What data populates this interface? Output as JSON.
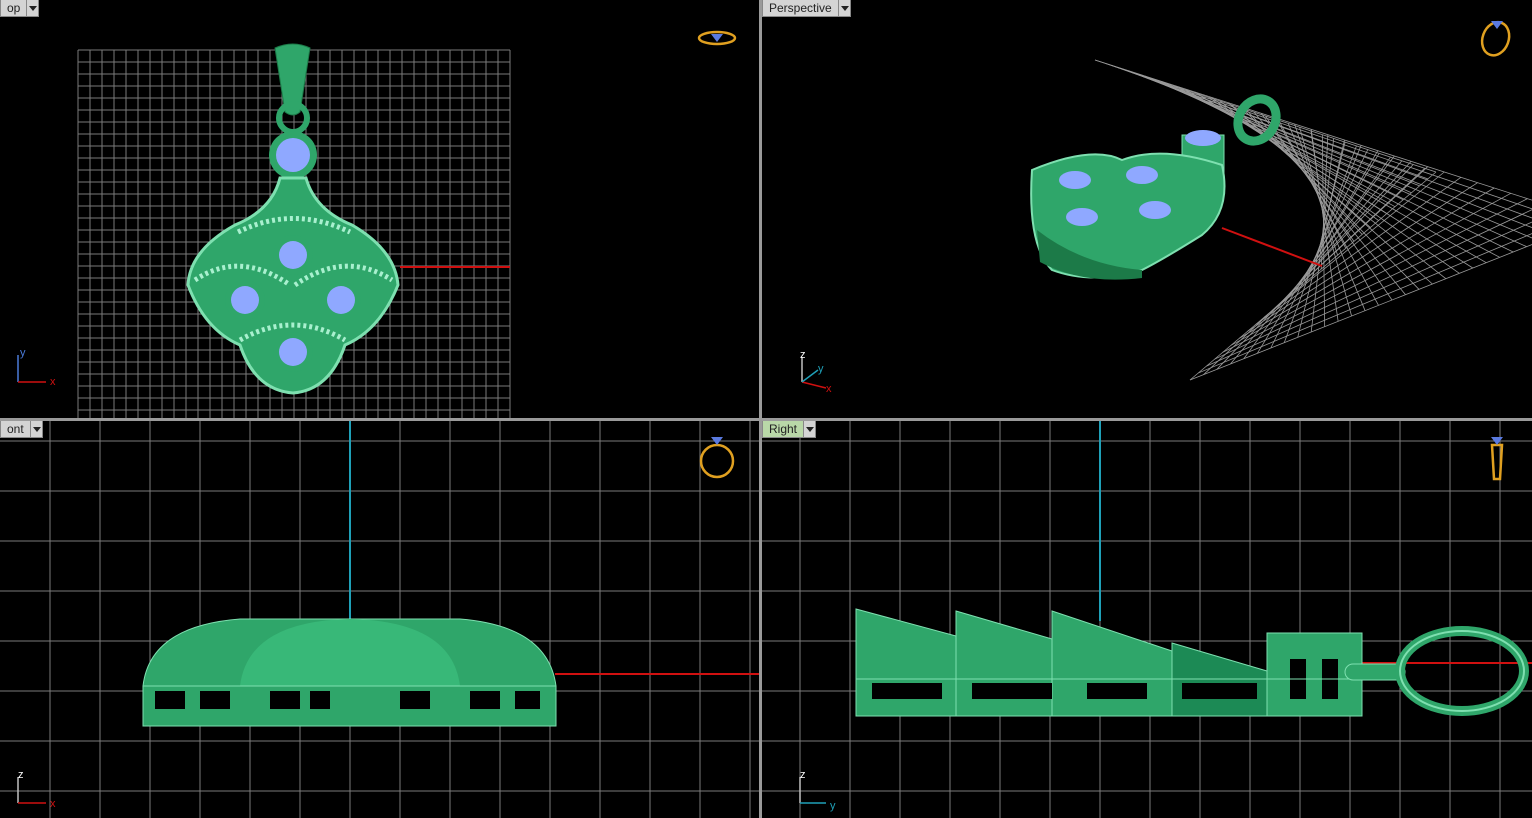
{
  "viewports": {
    "top": {
      "label": "op",
      "axes": {
        "vertical": "y",
        "horizontal": "x"
      }
    },
    "perspective": {
      "label": "Perspective",
      "axes": {
        "vertical": "z",
        "horizontal": "x",
        "depth": "y"
      }
    },
    "front": {
      "label": "ont",
      "axes": {
        "vertical": "z",
        "horizontal": "x"
      }
    },
    "right": {
      "label": "Right",
      "axes": {
        "vertical": "z",
        "horizontal": "y"
      }
    }
  },
  "icons": {
    "top": "ring-top-icon",
    "perspective": "ring-perspective-icon",
    "front": "ring-front-icon",
    "right": "ring-right-icon"
  },
  "colors": {
    "background": "#000000",
    "grid": "#8a8a8a",
    "model": "#2fa66a",
    "model_light": "#7ee0b0",
    "gem": "#8fa8ff",
    "x_axis": "#d01010",
    "z_axis": "#1fa0b8",
    "icon": "#e0a020",
    "divider": "#9a9a9a"
  }
}
